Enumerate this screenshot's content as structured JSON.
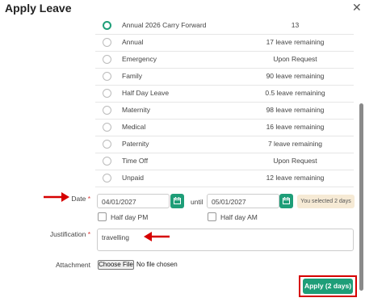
{
  "dialog": {
    "title": "Apply Leave",
    "close_icon": "close-icon"
  },
  "leave_types": [
    {
      "name": "Annual 2026 Carry Forward",
      "balance": "13",
      "selected": true
    },
    {
      "name": "Annual",
      "balance": "17 leave remaining",
      "selected": false
    },
    {
      "name": "Emergency",
      "balance": "Upon Request",
      "selected": false
    },
    {
      "name": "Family",
      "balance": "90 leave remaining",
      "selected": false
    },
    {
      "name": "Half Day Leave",
      "balance": "0.5 leave remaining",
      "selected": false
    },
    {
      "name": "Maternity",
      "balance": "98 leave remaining",
      "selected": false
    },
    {
      "name": "Medical",
      "balance": "16 leave remaining",
      "selected": false
    },
    {
      "name": "Paternity",
      "balance": "7 leave remaining",
      "selected": false
    },
    {
      "name": "Time Off",
      "balance": "Upon Request",
      "selected": false
    },
    {
      "name": "Unpaid",
      "balance": "12 leave remaining",
      "selected": false
    }
  ],
  "date": {
    "label": "Date",
    "required_mark": "*",
    "from_value": "04/01/2027",
    "until_label": "until",
    "to_value": "05/01/2027",
    "selected_text": "You selected 2 days",
    "half_day_pm_label": "Half day PM",
    "half_day_am_label": "Half day AM"
  },
  "justification": {
    "label": "Justification",
    "required_mark": "*",
    "value": "travelling"
  },
  "attachment": {
    "label": "Attachment",
    "button_label": "Choose File",
    "status_text": "No file chosen"
  },
  "apply_button": {
    "label": "Apply (2 days)"
  },
  "colors": {
    "accent": "#1e9e78",
    "annotation": "#d60000",
    "badge_bg": "#f6ead5"
  }
}
